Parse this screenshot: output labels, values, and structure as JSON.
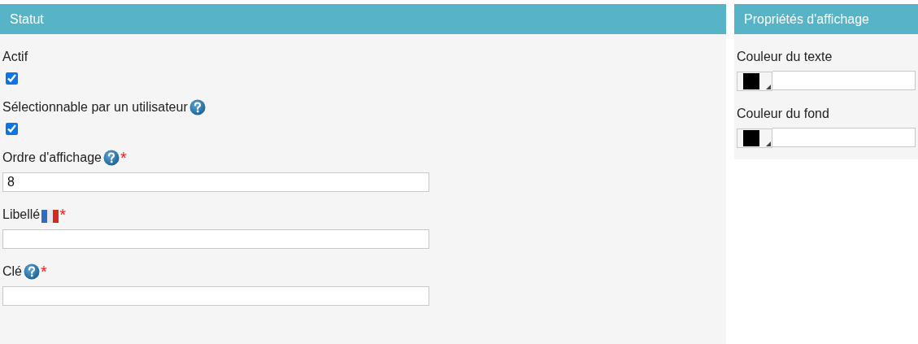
{
  "panels": [
    {
      "title": "Statut",
      "fields": [
        {
          "kind": "checkbox",
          "label": "Actif",
          "checked": true
        },
        {
          "kind": "checkbox",
          "label": "Sélectionnable par un utilisateur",
          "help": true,
          "checked": true
        },
        {
          "kind": "text",
          "label": "Ordre d'affichage",
          "help": true,
          "required_mark": "*",
          "value": "8"
        },
        {
          "kind": "text",
          "label": "Libellé",
          "flag": true,
          "required_mark": "*"
        },
        {
          "kind": "text",
          "label": "Clé",
          "help": true,
          "required_mark": "*"
        }
      ]
    },
    {
      "title": "Propriétés d'affichage",
      "fields": [
        {
          "kind": "color",
          "label": "Couleur du texte",
          "color": "#000000"
        },
        {
          "kind": "color",
          "label": "Couleur du fond",
          "color": "#000000"
        }
      ]
    }
  ]
}
